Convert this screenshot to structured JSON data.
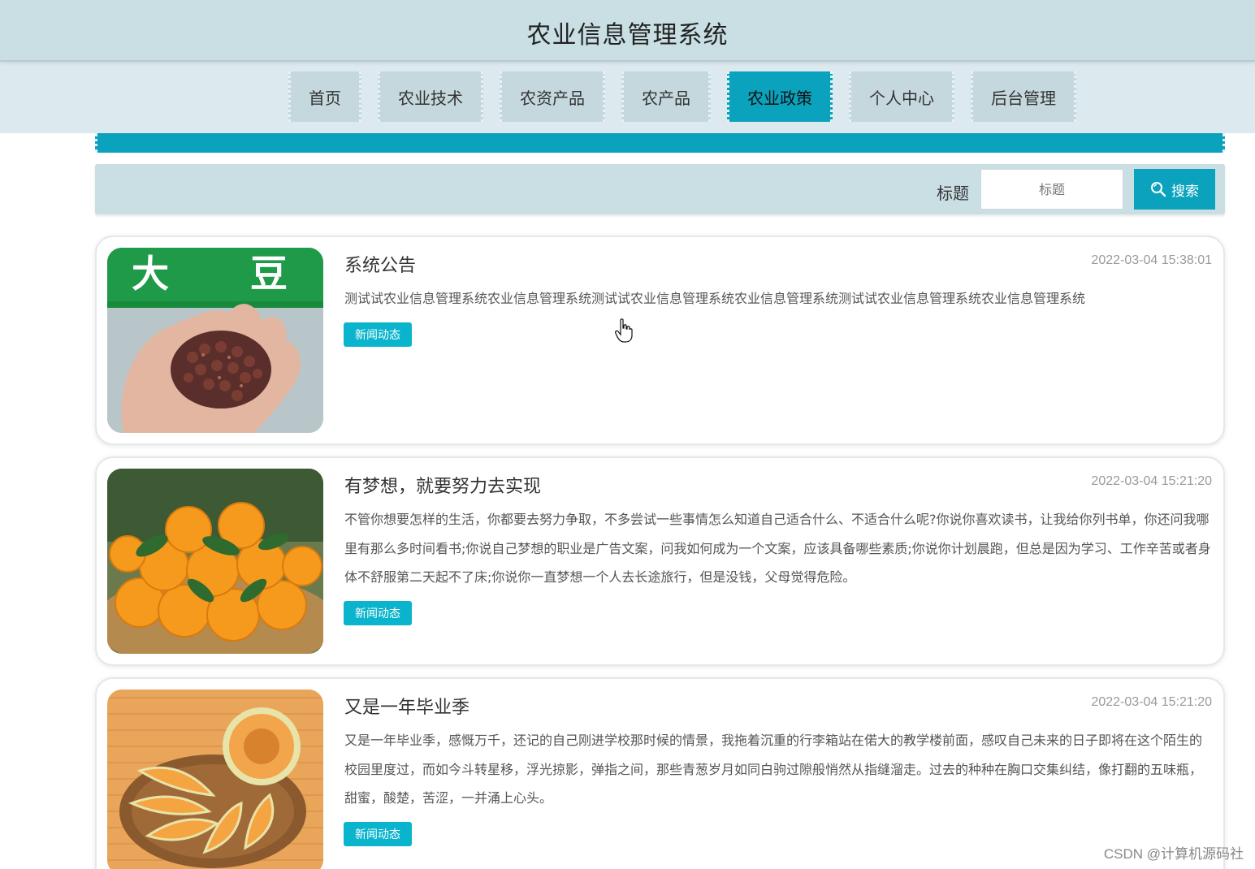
{
  "site": {
    "title": "农业信息管理系统"
  },
  "nav": {
    "items": [
      {
        "label": "首页",
        "active": false
      },
      {
        "label": "农业技术",
        "active": false
      },
      {
        "label": "农资产品",
        "active": false
      },
      {
        "label": "农产品",
        "active": false
      },
      {
        "label": "农业政策",
        "active": true
      },
      {
        "label": "个人中心",
        "active": false
      },
      {
        "label": "后台管理",
        "active": false
      }
    ]
  },
  "search": {
    "label": "标题",
    "placeholder": "标题",
    "button_label": "搜索",
    "button_icon": "search-icon"
  },
  "news": [
    {
      "title": "系统公告",
      "time": "2022-03-04 15:38:01",
      "summary": "测试试农业信息管理系统农业信息管理系统测试试农业信息管理系统农业信息管理系统测试试农业信息管理系统农业信息管理系统",
      "tag": "新闻动态",
      "image": "beans-in-hand",
      "image_text_1": "大",
      "image_text_2": "豆"
    },
    {
      "title": "有梦想，就要努力去实现",
      "time": "2022-03-04 15:21:20",
      "summary": "不管你想要怎样的生活，你都要去努力争取，不多尝试一些事情怎么知道自己适合什么、不适合什么呢?你说你喜欢读书，让我给你列书单，你还问我哪里有那么多时间看书;你说自己梦想的职业是广告文案，问我如何成为一个文案，应该具备哪些素质;你说你计划晨跑，但总是因为学习、工作辛苦或者身体不舒服第二天起不了床;你说你一直梦想一个人去长途旅行，但是没钱，父母觉得危险。",
      "tag": "新闻动态",
      "image": "oranges-basket"
    },
    {
      "title": "又是一年毕业季",
      "time": "2022-03-04 15:21:20",
      "summary": "又是一年毕业季，感慨万千，还记的自己刚进学校那时候的情景，我拖着沉重的行李箱站在偌大的教学楼前面，感叹自己未来的日子即将在这个陌生的校园里度过，而如今斗转星移，浮光掠影，弹指之间，那些青葱岁月如同白驹过隙般悄然从指缝溜走。过去的种种在胸口交集纠结，像打翻的五味瓶，甜蜜，酸楚，苦涩，一并涌上心头。",
      "tag": "新闻动态",
      "image": "melon-slices"
    }
  ],
  "watermark": "CSDN @计算机源码社",
  "colors": {
    "accent": "#0aa2bd",
    "header_bg": "#c9dfe4",
    "nav_bg": "#dce9ef",
    "tag_bg": "#0ab4cc"
  }
}
